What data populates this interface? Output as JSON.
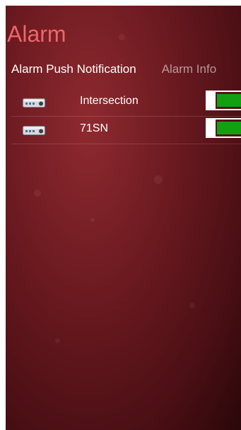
{
  "app": {
    "title": "Alarm"
  },
  "pivot": {
    "tabs": [
      {
        "label": "Alarm Push Notification",
        "active": true
      },
      {
        "label": "Alarm Info",
        "active": false
      }
    ]
  },
  "devices": [
    {
      "name": "Intersection",
      "icon": "dvr-device-icon",
      "push_enabled": true
    },
    {
      "name": "71SN",
      "icon": "dvr-device-icon",
      "push_enabled": true
    }
  ],
  "colors": {
    "title": "#f0656b",
    "toggle_on": "#12a012",
    "background": "#6b1a20"
  }
}
